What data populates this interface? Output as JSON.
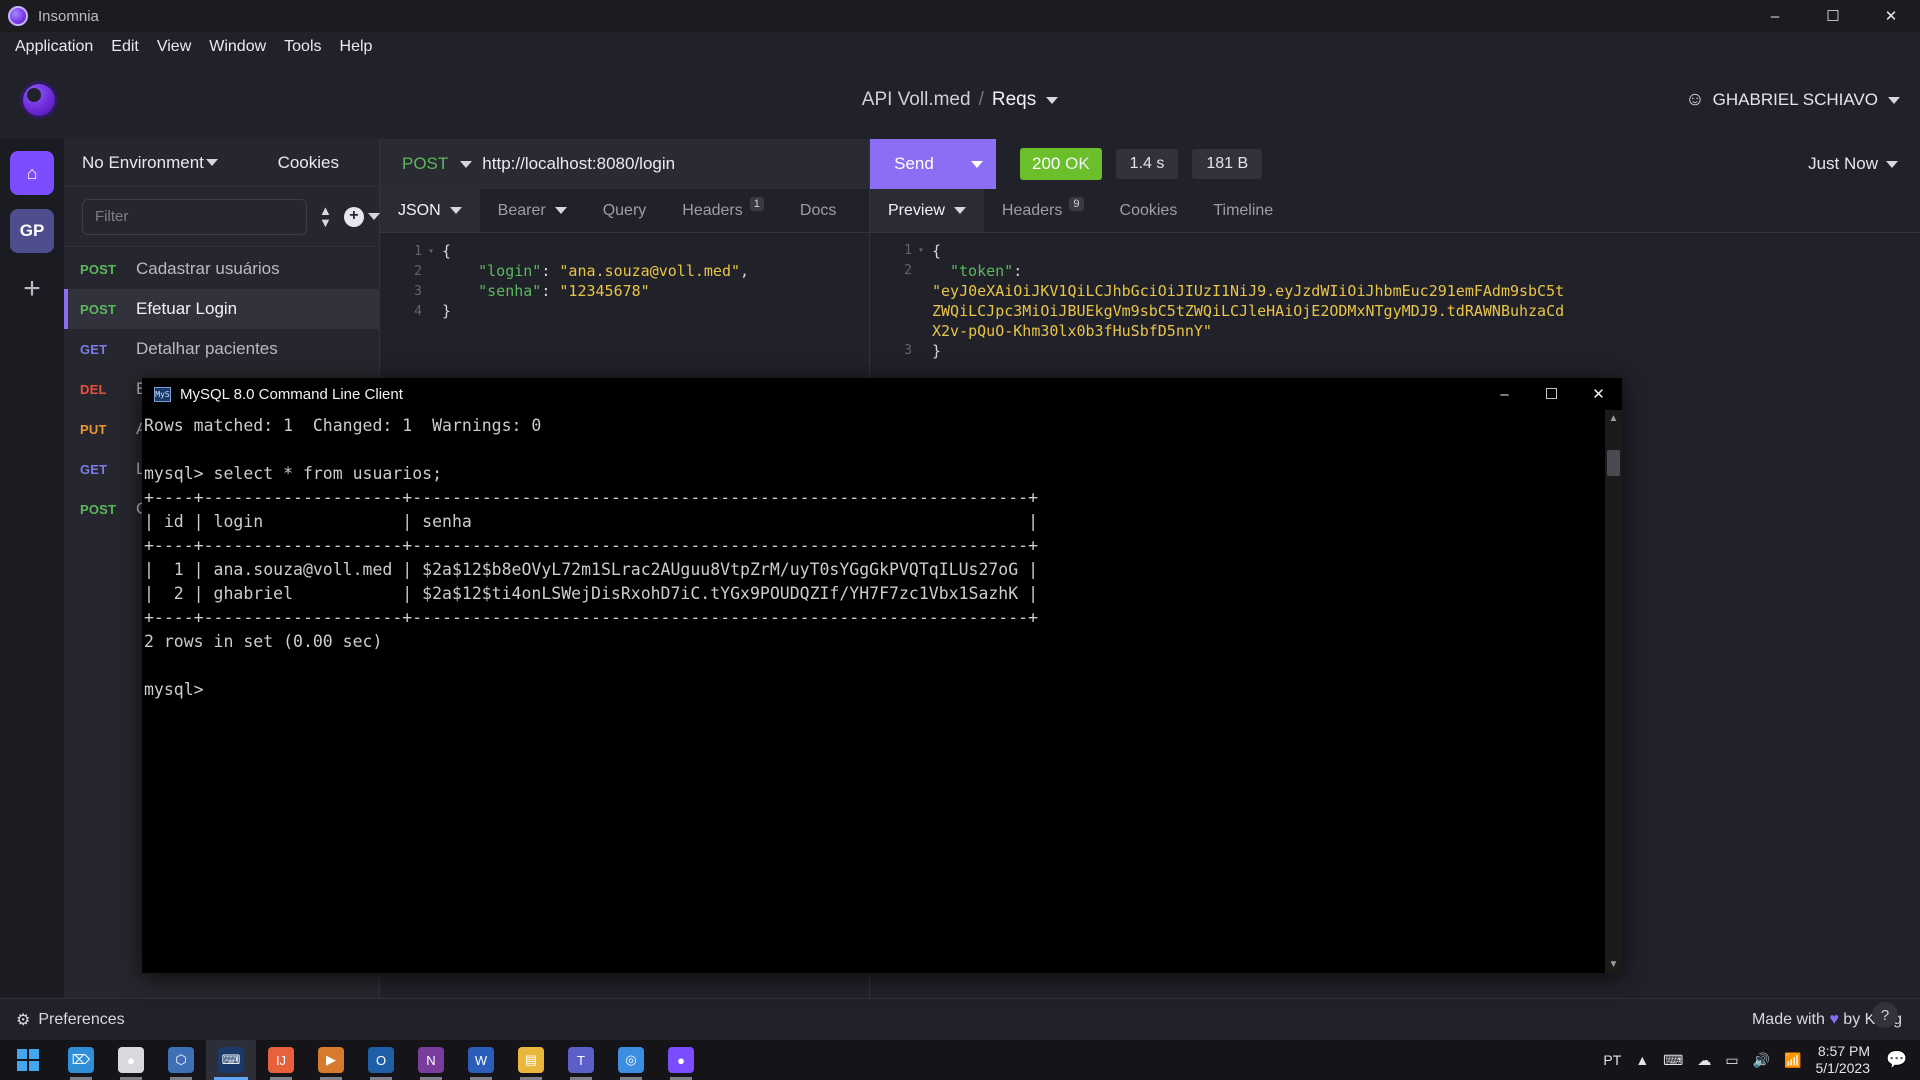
{
  "window": {
    "app_title": "Insomnia",
    "minimize": "–",
    "maximize": "☐",
    "close": "✕"
  },
  "menubar": {
    "items": [
      "Application",
      "Edit",
      "View",
      "Window",
      "Tools",
      "Help"
    ]
  },
  "header": {
    "workspace": "API Voll.med",
    "separator": "/",
    "project": "Reqs",
    "user": "GHABRIEL SCHIAVO"
  },
  "activitybar": {
    "home_icon": "⌂",
    "workspace_initials": "GP",
    "add_icon": "+"
  },
  "sidebar": {
    "environment": "No Environment",
    "cookies": "Cookies",
    "filter_placeholder": "Filter",
    "filter_value": "",
    "requests": [
      {
        "method": "POST",
        "name": "Cadastrar usuários",
        "active": false
      },
      {
        "method": "POST",
        "name": "Efetuar Login",
        "active": true
      },
      {
        "method": "GET",
        "name": "Detalhar pacientes",
        "active": false
      },
      {
        "method": "DEL",
        "name": "Excluir médicos",
        "active": false
      },
      {
        "method": "PUT",
        "name": "Atu",
        "active": false
      },
      {
        "method": "GET",
        "name": "Lis",
        "active": false
      },
      {
        "method": "POST",
        "name": "Ca",
        "active": false
      }
    ]
  },
  "request": {
    "method": "POST",
    "url": "http://localhost:8080/login",
    "tabs": [
      {
        "label": "JSON",
        "caret": true,
        "badge": "",
        "active": true
      },
      {
        "label": "Bearer",
        "caret": true,
        "badge": "",
        "active": false
      },
      {
        "label": "Query",
        "caret": false,
        "badge": "",
        "active": false
      },
      {
        "label": "Headers",
        "caret": false,
        "badge": "1",
        "active": false
      },
      {
        "label": "Docs",
        "caret": false,
        "badge": "",
        "active": false
      }
    ],
    "body_lines": [
      {
        "no": "1",
        "fold": "▾",
        "parts": [
          {
            "t": "{",
            "c": "c-punc"
          }
        ]
      },
      {
        "no": "2",
        "fold": "",
        "parts": [
          {
            "t": "    ",
            "c": "c-punc"
          },
          {
            "t": "\"login\"",
            "c": "c-key"
          },
          {
            "t": ": ",
            "c": "c-punc"
          },
          {
            "t": "\"ana.souza@voll.med\"",
            "c": "c-str"
          },
          {
            "t": ",",
            "c": "c-punc"
          }
        ]
      },
      {
        "no": "3",
        "fold": "",
        "parts": [
          {
            "t": "    ",
            "c": "c-punc"
          },
          {
            "t": "\"senha\"",
            "c": "c-key"
          },
          {
            "t": ": ",
            "c": "c-punc"
          },
          {
            "t": "\"12345678\"",
            "c": "c-str"
          }
        ]
      },
      {
        "no": "4",
        "fold": "",
        "parts": [
          {
            "t": "}",
            "c": "c-punc"
          }
        ]
      }
    ]
  },
  "response": {
    "send_label": "Send",
    "status_code": "200",
    "status_text": "OK",
    "time": "1.4 s",
    "size": "181 B",
    "timestamp": "Just Now",
    "tabs": [
      {
        "label": "Preview",
        "caret": true,
        "badge": "",
        "active": true
      },
      {
        "label": "Headers",
        "caret": false,
        "badge": "9",
        "active": false
      },
      {
        "label": "Cookies",
        "caret": false,
        "badge": "",
        "active": false
      },
      {
        "label": "Timeline",
        "caret": false,
        "badge": "",
        "active": false
      }
    ],
    "line1_no": "1",
    "line1_text": "{",
    "line2_no": "2",
    "line2_key": "\"token\"",
    "token_value": "\"eyJ0eXAiOiJKV1QiLCJhbGciOiJIUzI1NiJ9.eyJzdWIiOiJhbmEuc291emFAdm9sbC5tZWQiLCJpc3MiOiJBUEkgVm9sbC5tZWQiLCJleHAiOjE2ODMxNTgyMDJ9.tdRAWNBuhzaCdX2v-pQuO-Khm30lx0b3fHuSbfD5nnY\"",
    "line3_no": "3",
    "line3_text": "}"
  },
  "mysql": {
    "title": "MySQL 8.0 Command Line Client",
    "icon_label": "MyS",
    "minimize": "–",
    "maximize": "☐",
    "close": "✕",
    "console_text": "Rows matched: 1  Changed: 1  Warnings: 0\n\nmysql> select * from usuarios;\n+----+--------------------+--------------------------------------------------------------+\n| id | login              | senha                                                        |\n+----+--------------------+--------------------------------------------------------------+\n|  1 | ana.souza@voll.med | $2a$12$b8eOVyL72m1SLrac2AUguu8VtpZrM/uyT0sYGgGkPVQTqILUs27oG |\n|  2 | ghabriel           | $2a$12$ti4onLSWejDisRxohD7iC.tYGx9POUDQZIf/YH7F7zc1Vbx1SazhK |\n+----+--------------------+--------------------------------------------------------------+\n2 rows in set (0.00 sec)\n\nmysql>",
    "scroll_up": "▲",
    "scroll_down": "▼"
  },
  "footer": {
    "preferences": "Preferences",
    "gear_icon": "⚙",
    "made_with_pre": "Made with ",
    "heart": "♥",
    "made_with_post": " by Kong",
    "help": "?"
  },
  "taskbar": {
    "apps": [
      {
        "name": "vscode",
        "glyph": "⌦",
        "color": "#2f8fd6",
        "state": "running"
      },
      {
        "name": "github",
        "glyph": "●",
        "color": "#d8d8de",
        "state": "running"
      },
      {
        "name": "editor",
        "glyph": "⬡",
        "color": "#3f6fb5",
        "state": "running"
      },
      {
        "name": "mysql",
        "glyph": "⌨",
        "color": "#1a3a6b",
        "state": "active"
      },
      {
        "name": "intellij",
        "glyph": "IJ",
        "color": "#e8603c",
        "state": "running"
      },
      {
        "name": "xampp",
        "glyph": "▶",
        "color": "#d87a2b",
        "state": "running"
      },
      {
        "name": "outlook",
        "glyph": "O",
        "color": "#1e5fa8",
        "state": "running"
      },
      {
        "name": "onenote",
        "glyph": "N",
        "color": "#7a3d9e",
        "state": "running"
      },
      {
        "name": "word",
        "glyph": "W",
        "color": "#2b5dbb",
        "state": "running"
      },
      {
        "name": "explorer",
        "glyph": "▤",
        "color": "#e8b73c",
        "state": "running"
      },
      {
        "name": "teams",
        "glyph": "T",
        "color": "#5b5fc7",
        "state": "running"
      },
      {
        "name": "chrome",
        "glyph": "◎",
        "color": "#3d8de0",
        "state": "running"
      },
      {
        "name": "insomnia",
        "glyph": "●",
        "color": "#7c4dff",
        "state": "running"
      }
    ],
    "language": "PT",
    "tray_icons": [
      "▲",
      "⌨",
      "☁",
      "▭",
      "🔊",
      "📶"
    ],
    "time": "8:57 PM",
    "date": "5/1/2023",
    "notification_icon": "💬"
  }
}
